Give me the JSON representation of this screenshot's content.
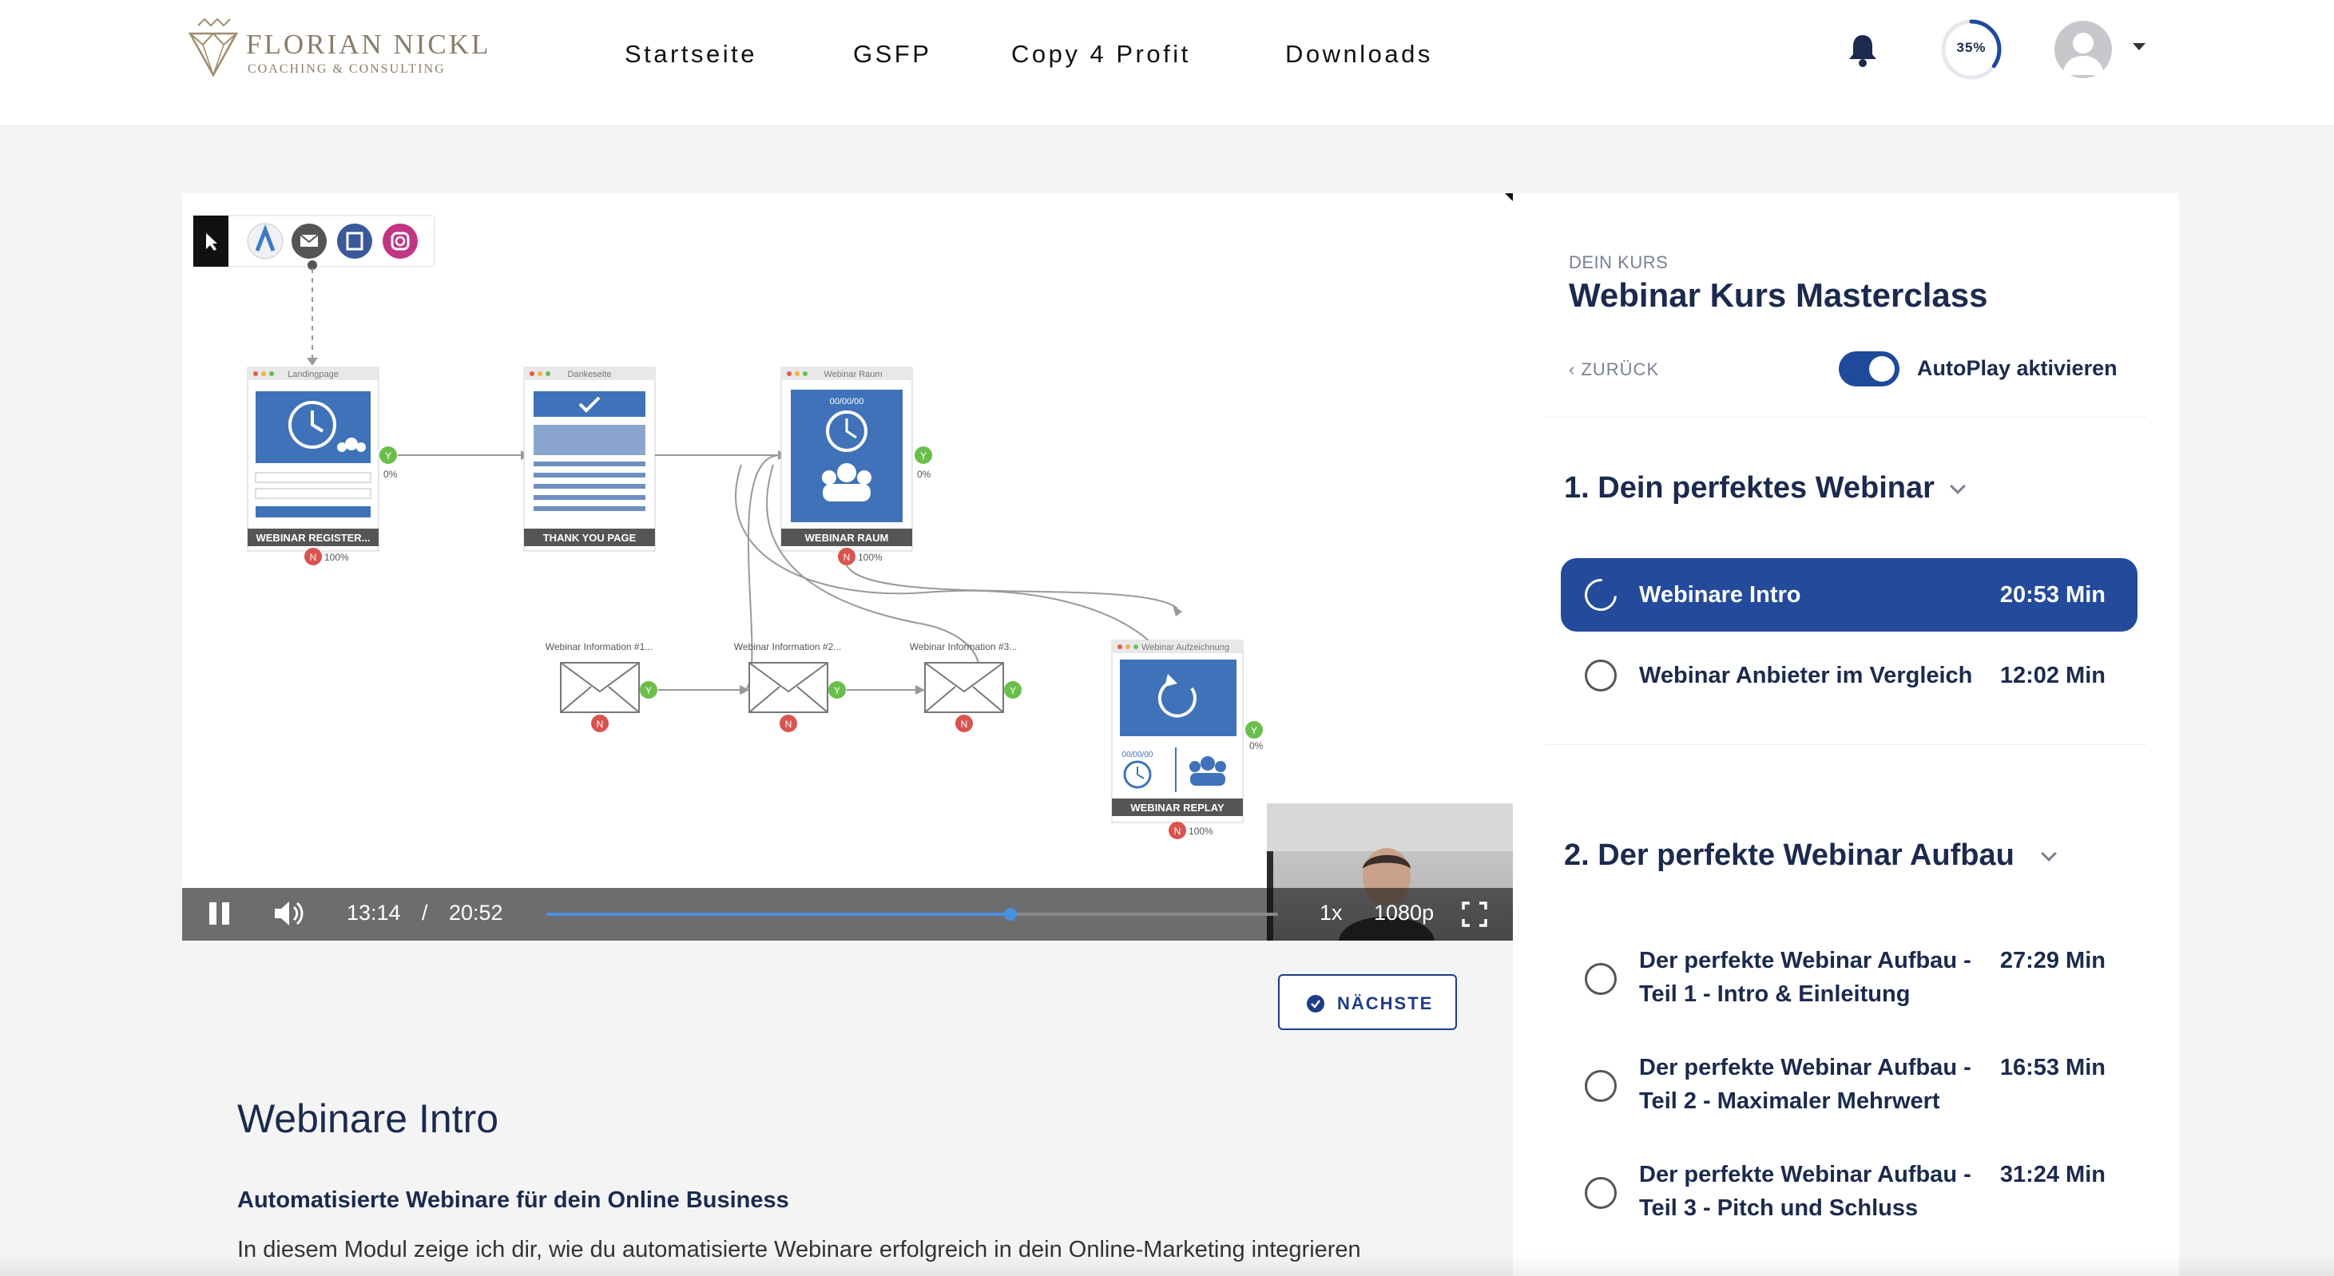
{
  "brand": {
    "name": "FLORIAN NICKL",
    "subtitle": "COACHING & CONSULTING",
    "icon": "diamond-crown-logo"
  },
  "nav": {
    "items": [
      {
        "label": "Startseite"
      },
      {
        "label": "GSFP"
      },
      {
        "label": "Copy 4 Profit"
      },
      {
        "label": "Downloads"
      }
    ]
  },
  "header": {
    "progress_label": "35%",
    "progress_value": 0.35,
    "notification_icon": "bell-icon",
    "avatar_icon": "user-avatar"
  },
  "video": {
    "diagram": {
      "labels": {
        "landing": "Landingpage",
        "danke": "Dankeseite",
        "raum": "Webinar Raum",
        "aufzeichnung": "Webinar Aufzeichnung",
        "info1": "Webinar Information #1...",
        "info2": "Webinar Information #2...",
        "info3": "Webinar Information #3...",
        "raum_date": "00/00/00",
        "replay_date": "00/00/00"
      },
      "captions": {
        "landing": "WEBINAR REGISTER...",
        "danke": "THANK YOU PAGE",
        "raum": "WEBINAR RAUM",
        "replay": "WEBINAR REPLAY"
      },
      "stats": {
        "yes": "Y",
        "no": "N",
        "landing_y": "0%",
        "landing_n": "100%",
        "raum_y": "0%",
        "raum_n": "100%",
        "replay_y": "0%",
        "replay_n": "100%"
      }
    },
    "controls": {
      "current_time": "13:14",
      "separator": "/",
      "duration": "20:52",
      "progress": 0.634,
      "speed": "1x",
      "quality": "1080p"
    }
  },
  "next_button": {
    "label": "NÄCHSTE"
  },
  "lesson": {
    "title": "Webinare Intro",
    "subtitle": "Automatisierte Webinare für dein Online Business",
    "description": "In diesem Modul zeige ich dir, wie du automatisierte Webinare erfolgreich in dein Online-Marketing integrieren"
  },
  "sidebar": {
    "kicker": "DEIN KURS",
    "course_title": "Webinar Kurs Masterclass",
    "back_label": "ZURÜCK",
    "autoplay_label": "AutoPlay aktivieren",
    "autoplay_on": true,
    "sections": [
      {
        "title": "1. Dein perfektes Webinar",
        "items": [
          {
            "title": "Webinare Intro",
            "duration": "20:53 Min",
            "active": true
          },
          {
            "title": "Webinar Anbieter im Vergleich",
            "duration": "12:02 Min",
            "active": false
          }
        ]
      },
      {
        "title": "2. Der perfekte Webinar Aufbau",
        "items": [
          {
            "title_line1": "Der perfekte Webinar Aufbau -",
            "title_line2": "Teil 1 - Intro & Einleitung",
            "duration": "27:29 Min"
          },
          {
            "title_line1": "Der perfekte Webinar Aufbau -",
            "title_line2": "Teil 2 - Maximaler Mehrwert",
            "duration": "16:53 Min"
          },
          {
            "title_line1": "Der perfekte Webinar Aufbau -",
            "title_line2": "Teil 3 - Pitch und Schluss",
            "duration": "31:24 Min"
          }
        ]
      }
    ]
  },
  "colors": {
    "accent": "#244a9b",
    "text": "#1b2a4e",
    "seek": "#4a90e2",
    "yes": "#6abf4b",
    "no": "#d9534f",
    "page": "#f4f4f5"
  }
}
